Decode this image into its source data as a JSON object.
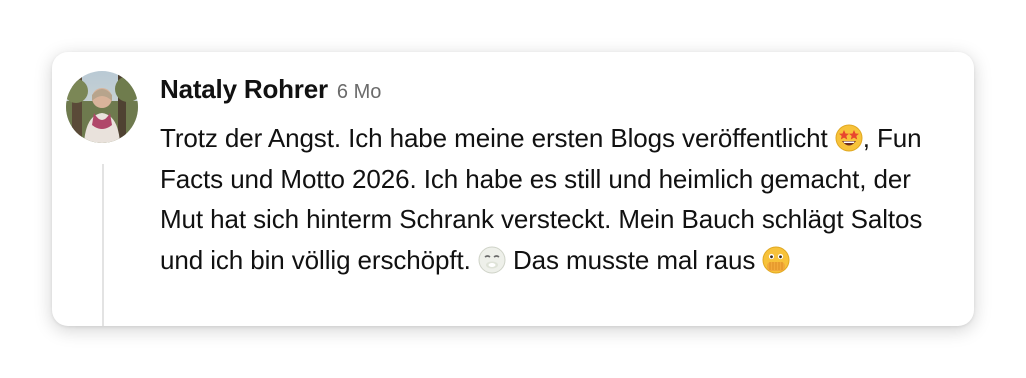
{
  "comment": {
    "author": "Nataly Rohrer",
    "time": "6 Mo",
    "avatar_icon": "user-avatar-photo",
    "text_part_1": "Trotz der Angst. Ich habe meine ersten Blogs veröffentlicht ",
    "emoji_1": "star-struck-emoji",
    "text_part_2": ", Fun Facts und Motto 2026. Ich habe es still und heimlich gemacht, der Mut hat sich hinterm Schrank versteckt. Mein Bauch schlägt Saltos und ich bin völlig erschöpft. ",
    "emoji_2": "face-exhaling-emoji",
    "text_part_3": " Das musste mal raus ",
    "emoji_3": "face-with-open-eyes-and-hand-over-mouth-emoji"
  },
  "colors": {
    "text": "#111111",
    "meta": "#6b6b6b",
    "card_background": "#ffffff",
    "thread_line": "#e3e3e3"
  }
}
